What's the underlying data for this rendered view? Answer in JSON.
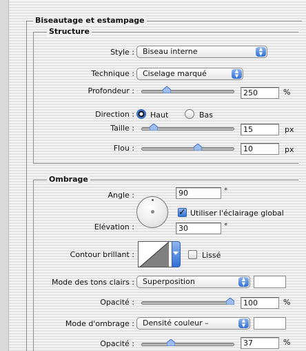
{
  "panel": {
    "bevel_title": "Biseautage et estampage",
    "structure": {
      "title": "Structure",
      "style_label": "Style :",
      "style_value": "Biseau interne",
      "technique_label": "Technique :",
      "technique_value": "Ciselage marqué",
      "depth_label": "Profondeur :",
      "depth_value": "250",
      "depth_unit": "%",
      "depth_slider": 0.25,
      "direction_label": "Direction :",
      "direction_up": "Haut",
      "direction_down": "Bas",
      "direction_selected": "Haut",
      "size_label": "Taille :",
      "size_value": "15",
      "size_unit": "px",
      "size_slider": 0.1,
      "soften_label": "Flou :",
      "soften_value": "10",
      "soften_unit": "px",
      "soften_slider": 0.62
    },
    "shading": {
      "title": "Ombrage",
      "angle_label": "Angle :",
      "angle_value": "90",
      "angle_unit": "°",
      "global_light_label": "Utiliser l'éclairage global",
      "global_light_checked": true,
      "altitude_label": "Elévation :",
      "altitude_value": "30",
      "altitude_unit": "°",
      "gloss_label": "Contour brillant :",
      "antialias_label": "Lissé",
      "antialias_checked": false,
      "highlight_mode_label": "Mode des tons clairs :",
      "highlight_mode_value": "Superposition",
      "highlight_opacity_label": "Opacité :",
      "highlight_opacity_value": "100",
      "highlight_opacity_unit": "%",
      "highlight_opacity_slider": 1.0,
      "shadow_mode_label": "Mode d'ombrage :",
      "shadow_mode_value": "Densité couleur –",
      "shadow_opacity_label": "Opacité :",
      "shadow_opacity_value": "37",
      "shadow_opacity_unit": "%",
      "shadow_opacity_slider": 0.3
    }
  }
}
